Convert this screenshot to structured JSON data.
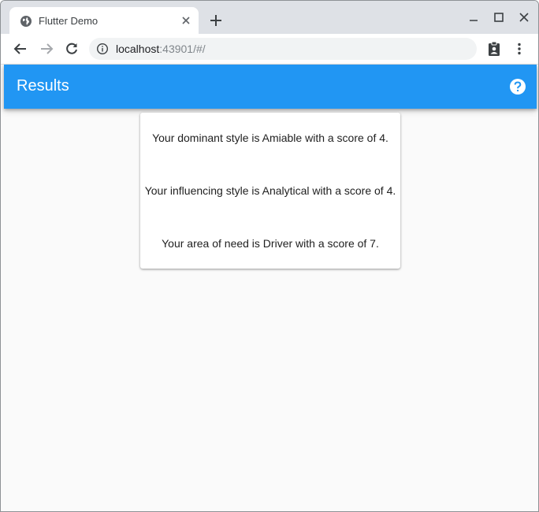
{
  "browser": {
    "tab": {
      "title": "Flutter Demo",
      "favicon": "globe-icon",
      "close_icon": "close-icon"
    },
    "new_tab_icon": "plus-icon",
    "window_controls": [
      "minimize-icon",
      "maximize-icon",
      "close-icon"
    ],
    "toolbar": {
      "back_icon": "arrow-left-icon",
      "forward_icon": "arrow-right-icon",
      "reload_icon": "reload-icon",
      "address": {
        "info_icon": "info-icon",
        "host": "localhost",
        "rest": ":43901/#/"
      },
      "extension_icon": "clipboard-account-icon",
      "menu_icon": "more-vert-icon"
    }
  },
  "app": {
    "appbar": {
      "title": "Results",
      "background": "#2196f3",
      "help_icon": "help-icon"
    },
    "results": [
      "Your dominant style is Amiable with a score of 4.",
      "Your influencing style is Analytical with a score of 4.",
      "Your area of need is Driver with a score of 7."
    ]
  }
}
